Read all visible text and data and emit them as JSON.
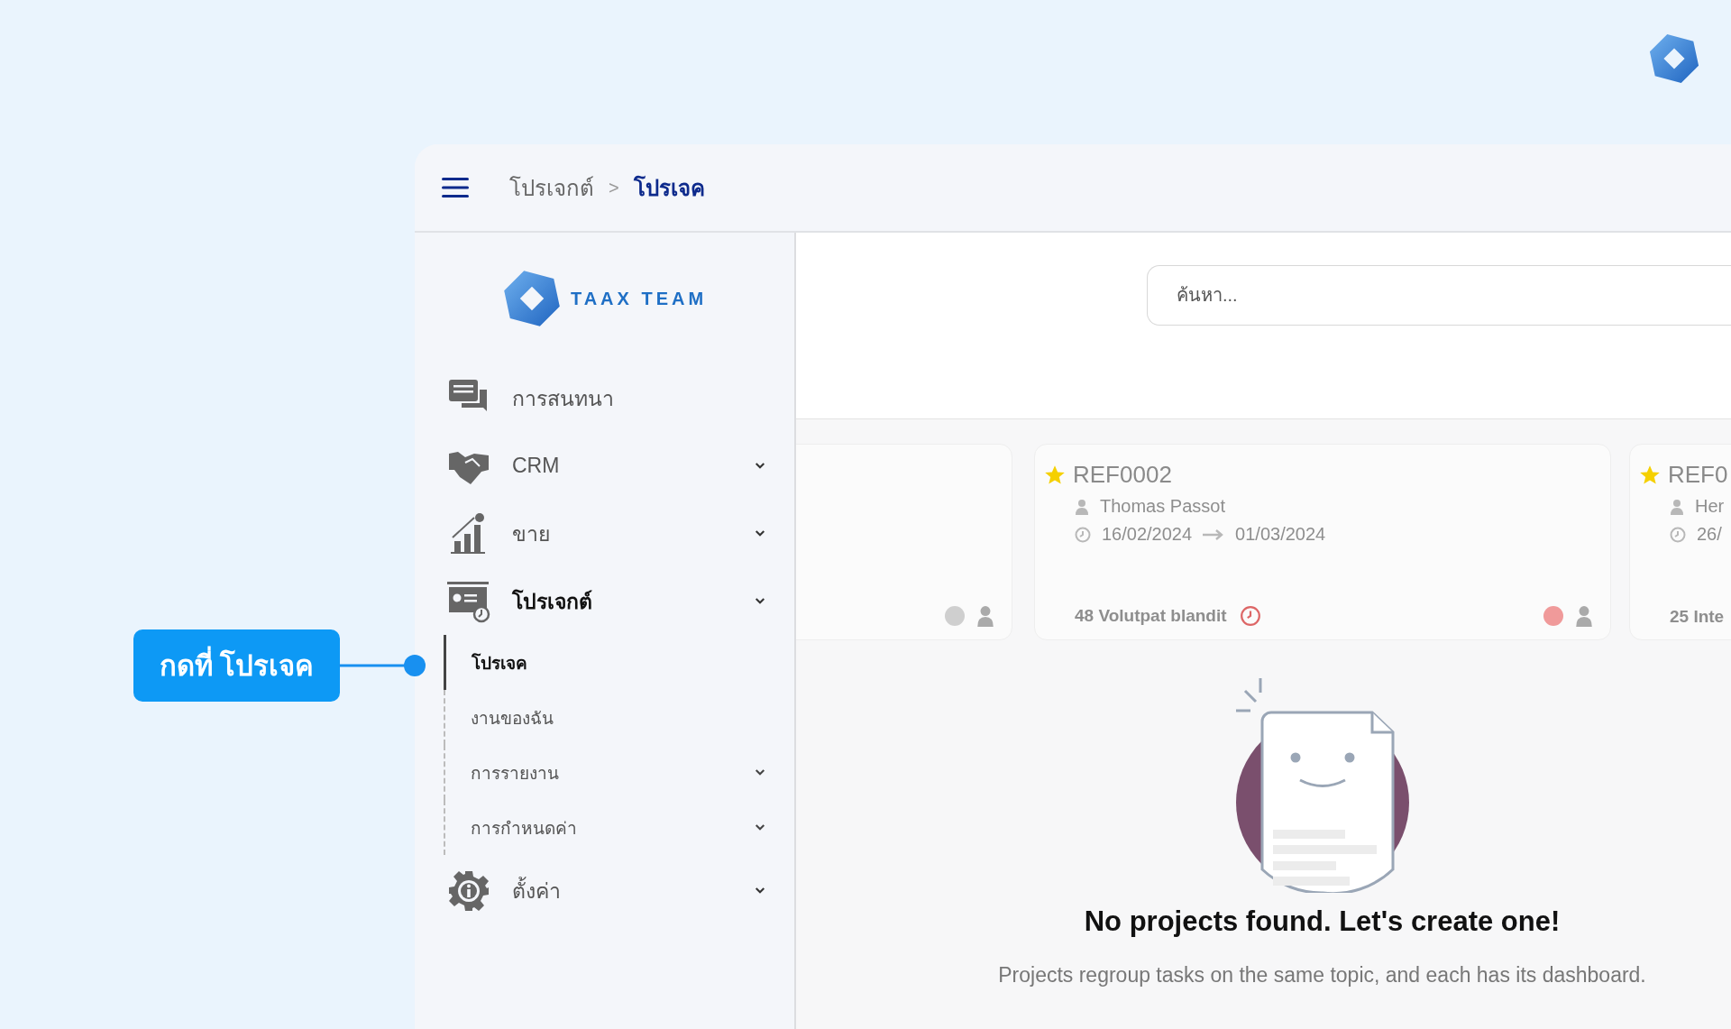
{
  "header": {
    "breadcrumbs": [
      {
        "label": "โปรเจกต์",
        "selected": false
      },
      {
        "label": "โปรเจค",
        "selected": true
      }
    ],
    "separator": ">"
  },
  "brand": {
    "name": "TAAX TEAM"
  },
  "sidebar": {
    "items": [
      {
        "label": "การสนทนา",
        "kind": "chat",
        "expandable": false,
        "selected": false
      },
      {
        "label": "CRM",
        "kind": "handshake",
        "expandable": true,
        "selected": false
      },
      {
        "label": "ขาย",
        "kind": "chart",
        "expandable": true,
        "selected": false
      },
      {
        "label": "โปรเจกต์",
        "kind": "project",
        "expandable": true,
        "selected": true,
        "children": [
          {
            "label": "โปรเจค",
            "expandable": false,
            "selected": true
          },
          {
            "label": "งานของฉัน",
            "expandable": false,
            "selected": false
          },
          {
            "label": "การรายงาน",
            "expandable": true,
            "selected": false
          },
          {
            "label": "การกำหนดค่า",
            "expandable": true,
            "selected": false
          }
        ]
      },
      {
        "label": "ตั้งค่า",
        "kind": "settings",
        "expandable": true,
        "selected": false
      }
    ]
  },
  "search": {
    "placeholder": "ค้นหา..."
  },
  "cards": [
    {
      "color": "#cfcfcf"
    },
    {
      "favorite": true,
      "ref": "REF0002",
      "person": "Thomas Passot",
      "start": "16/02/2024",
      "end": "01/03/2024",
      "footer": "48 Volutpat blandit",
      "color": "#f09a9a"
    },
    {
      "favorite": true,
      "ref": "REF0",
      "person": "Her",
      "start": "26/",
      "footer": "25 Inte"
    }
  ],
  "empty_state": {
    "title": "No projects found. Let's create one!",
    "text": "Projects regroup tasks on the same topic, and each has its dashboard."
  },
  "callout": {
    "text": "กดที่ โปรเจค"
  }
}
